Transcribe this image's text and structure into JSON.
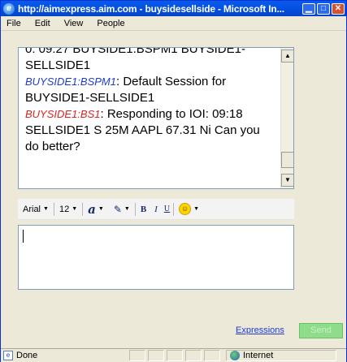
{
  "window": {
    "title": "http://aimexpress.aim.com - buysidesellside - Microsoft In...",
    "buttons": {
      "minimize": "▁",
      "maximize": "□",
      "close": "✕"
    }
  },
  "menu": [
    {
      "label": "File"
    },
    {
      "label": "Edit"
    },
    {
      "label": "View"
    },
    {
      "label": "People"
    }
  ],
  "history": {
    "partial_line": "0: 09:27 BUYSIDE1.BSPM1 BUYSIDE1-",
    "line2": "SELLSIDE1",
    "messages": [
      {
        "sender": "BUYSIDE1:BSPM1",
        "text": " Default Session for BUYSIDE1-SELLSIDE1"
      },
      {
        "sender": "BUYSIDE1:BS1",
        "text": " Responding to IOI: 09:18 SELLSIDE1  S  25M  AAPL  67.31  Ni Can you do better?"
      }
    ]
  },
  "toolbar": {
    "font": "Arial",
    "size": "12",
    "text_color_icon": "a",
    "highlight_icon": "✎",
    "bold": "B",
    "italic": "I",
    "underline": "U",
    "smiley": "☺"
  },
  "compose": {
    "value": ""
  },
  "expressions_label": "Expressions",
  "send_label": "Send",
  "status": {
    "text": "Done",
    "zone": "Internet"
  },
  "colors": {
    "title_bar": "#0453e6",
    "sender_blue": "#1f3bd4",
    "sender_red": "#e2201e",
    "send_button": "#8fdc8a"
  }
}
